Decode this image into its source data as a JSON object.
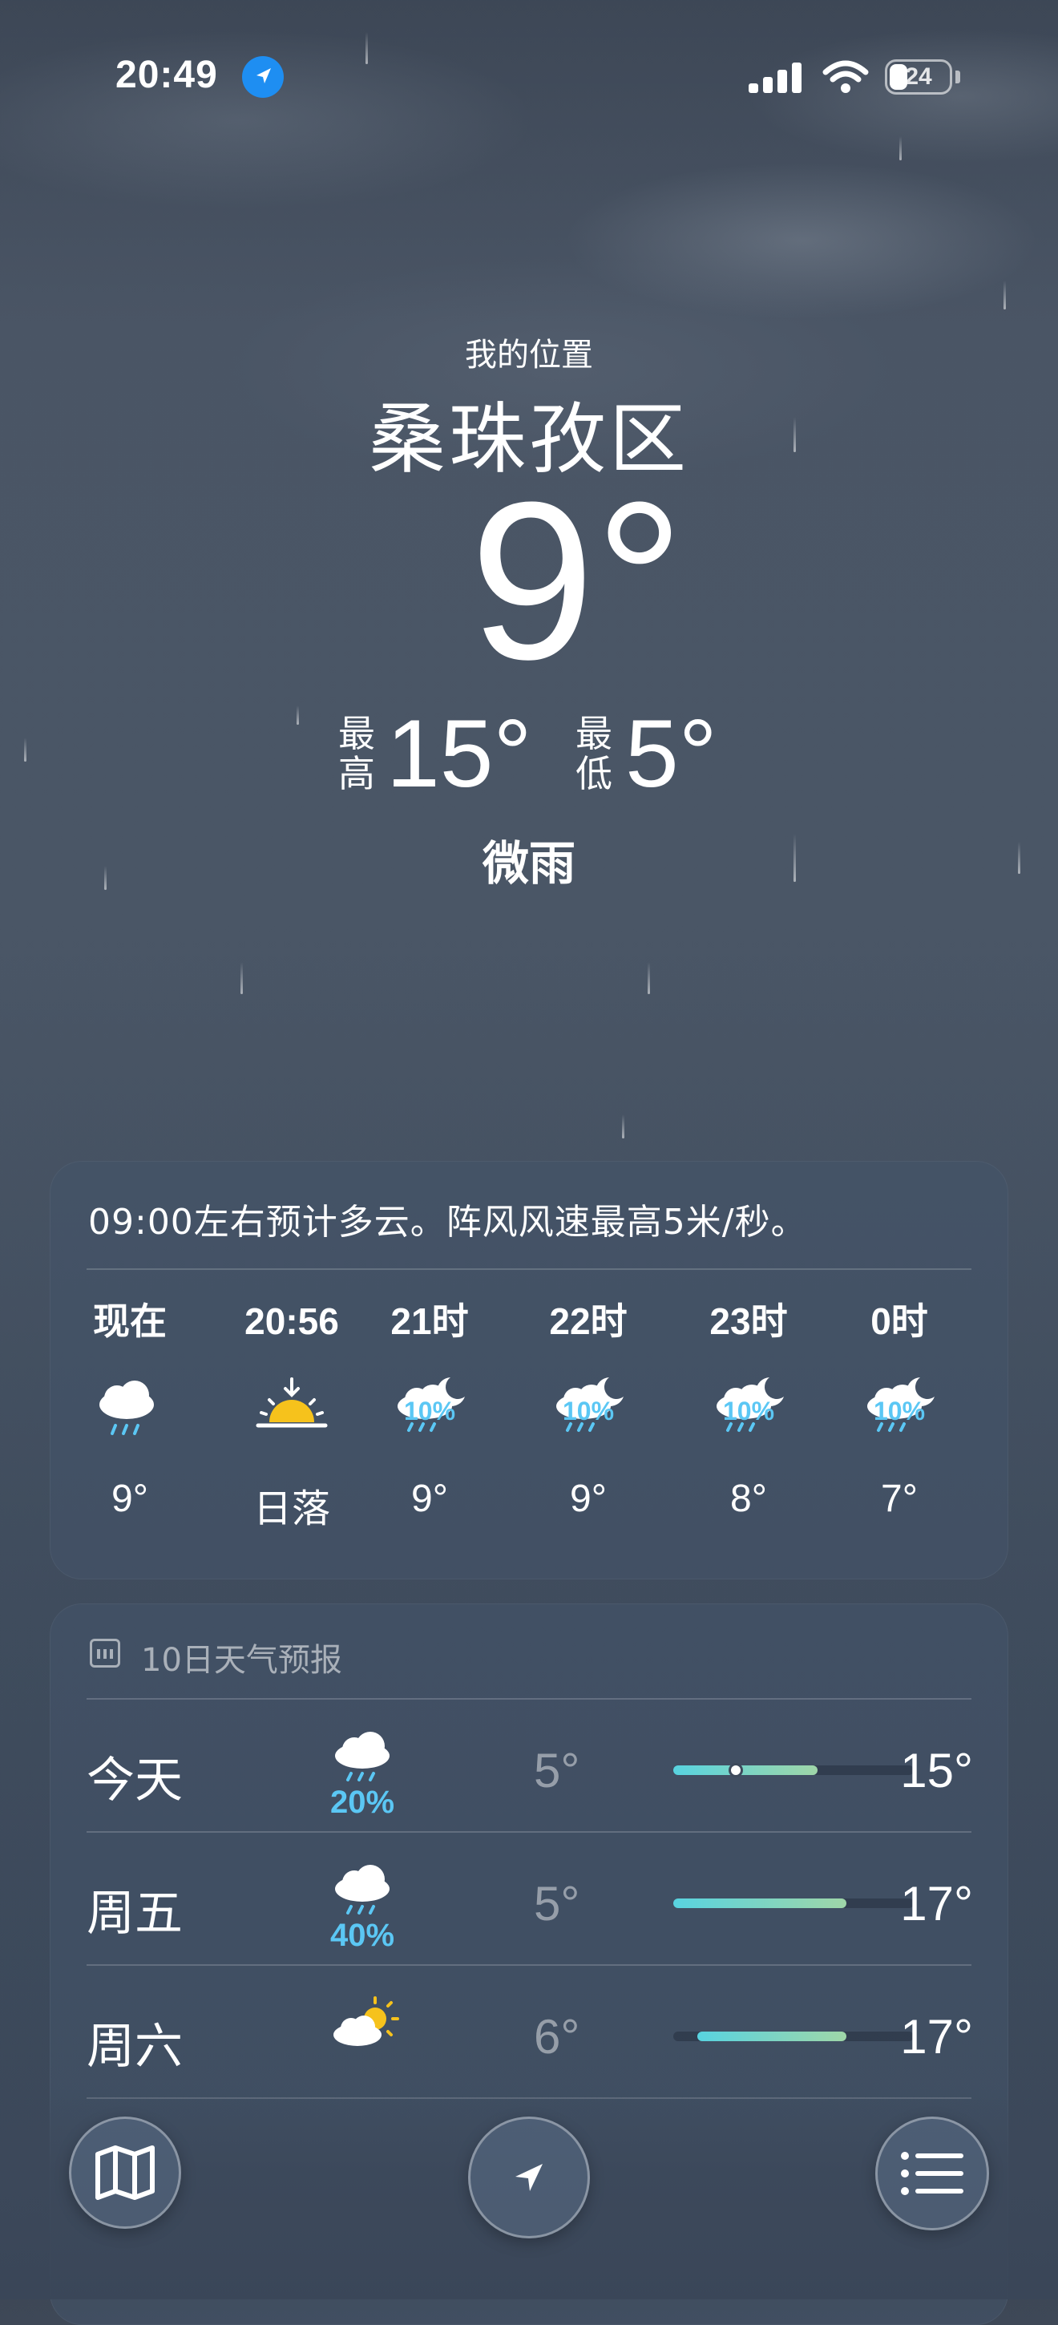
{
  "status_bar": {
    "time": "20:49",
    "battery": "24"
  },
  "location": {
    "label": "我的位置",
    "city": "桑珠孜区"
  },
  "current": {
    "temp": "9°",
    "high_label": "最高",
    "high": "15°",
    "low_label": "最低",
    "low": "5°",
    "condition": "微雨"
  },
  "hourly": {
    "summary": "09:00左右预计多云。阵风风速最高5米/秒。",
    "items": [
      {
        "time": "现在",
        "icon": "rain-cloud-icon",
        "precip": "",
        "temp": "9°"
      },
      {
        "time": "20:56",
        "icon": "sunset-icon",
        "precip": "",
        "temp": "日落"
      },
      {
        "time": "21时",
        "icon": "night-rain-icon",
        "precip": "10%",
        "temp": "9°"
      },
      {
        "time": "22时",
        "icon": "night-rain-icon",
        "precip": "10%",
        "temp": "9°"
      },
      {
        "time": "23时",
        "icon": "night-rain-icon",
        "precip": "10%",
        "temp": "8°"
      },
      {
        "time": "0时",
        "icon": "night-rain-icon",
        "precip": "10%",
        "temp": "7°"
      }
    ]
  },
  "daily": {
    "title": "10日天气预报",
    "days": [
      {
        "day": "今天",
        "icon": "rain-cloud-icon",
        "precip": "20%",
        "low": "5°",
        "high": "15°",
        "range_start": 0.0,
        "range_end": 0.6,
        "current_marker": 0.26
      },
      {
        "day": "周五",
        "icon": "rain-cloud-icon",
        "precip": "40%",
        "low": "5°",
        "high": "17°",
        "range_start": 0.0,
        "range_end": 0.72
      },
      {
        "day": "周六",
        "icon": "partly-sunny-icon",
        "precip": "",
        "low": "6°",
        "high": "17°",
        "range_start": 0.1,
        "range_end": 0.72
      }
    ]
  },
  "colors": {
    "precip": "#5bc7f4",
    "location_arrow": "#1e8ef2",
    "sun": "#f6c21c"
  },
  "toolbar": {
    "map": "map-icon",
    "location": "location-arrow-icon",
    "list": "list-icon"
  }
}
